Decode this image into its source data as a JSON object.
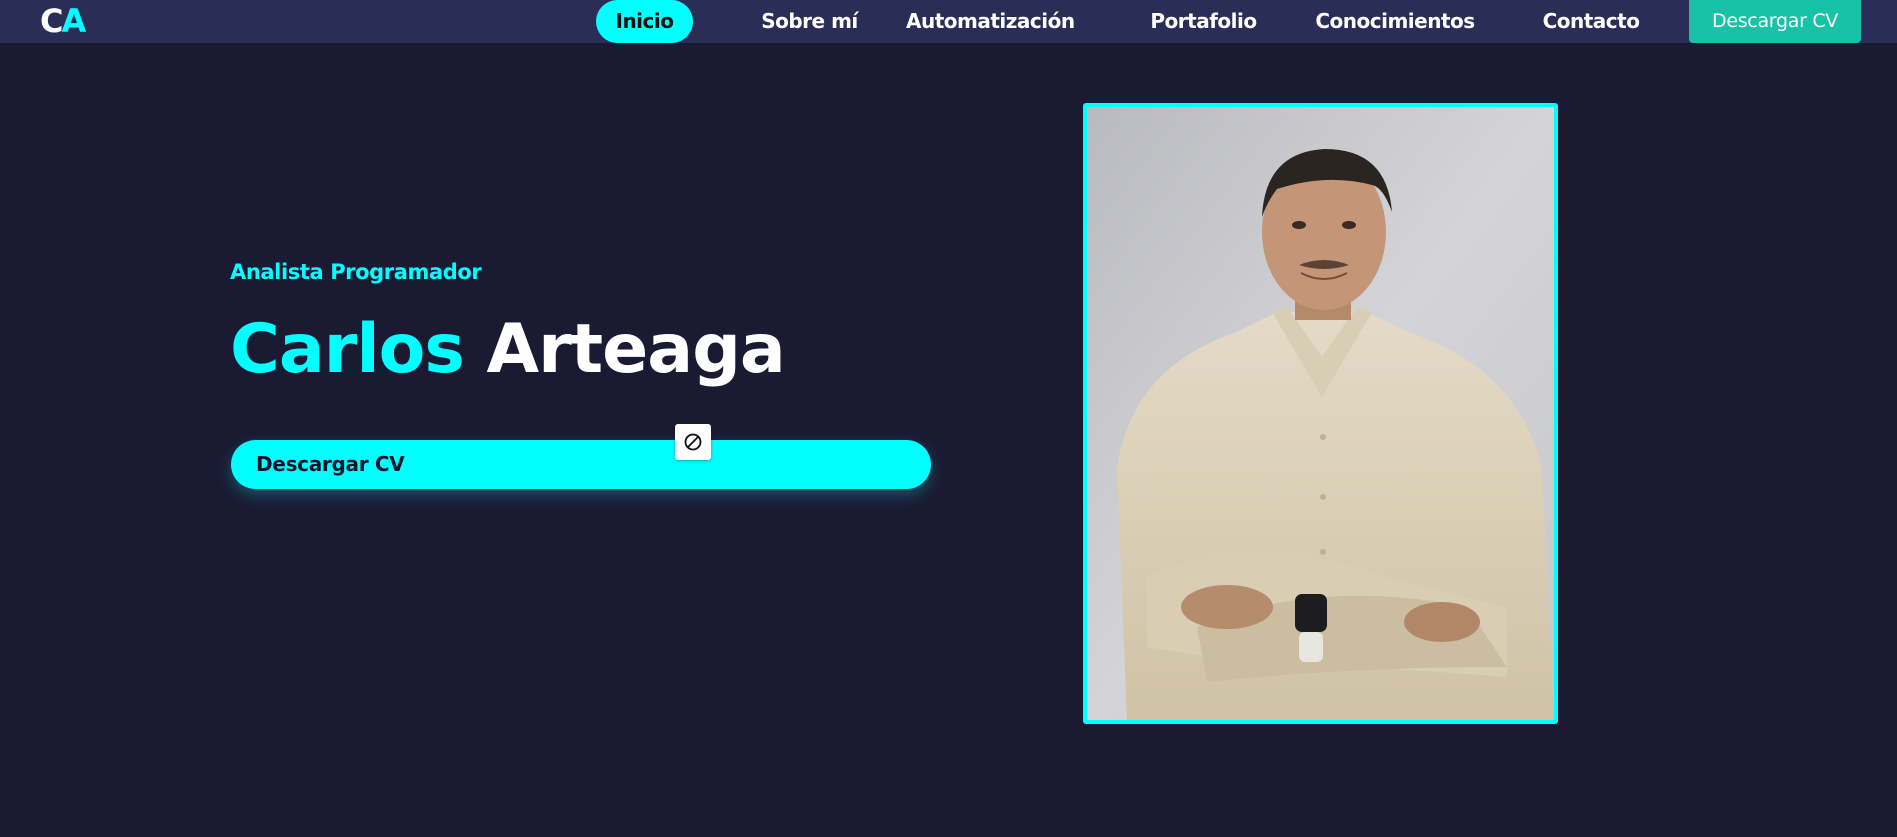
{
  "logo": {
    "c": "C",
    "a": "A"
  },
  "nav": {
    "items": [
      {
        "label": "Inicio",
        "active": true
      },
      {
        "label": "Sobre mí"
      },
      {
        "label": "Automatización"
      },
      {
        "label": "Portafolio"
      },
      {
        "label": "Conocimientos"
      },
      {
        "label": "Contacto"
      }
    ],
    "cv_label": "Descargar CV"
  },
  "hero": {
    "subtitle": "Analista Programador",
    "first_name": "Carlos",
    "last_name": "Arteaga",
    "cv_label": "Descargar CV"
  },
  "colors": {
    "background": "#1a1b33",
    "navbar": "#2a2d56",
    "accent": "#00ffff",
    "cv_nav_button": "#17c2a6"
  },
  "icons": {
    "cursor": "not-allowed-icon"
  }
}
